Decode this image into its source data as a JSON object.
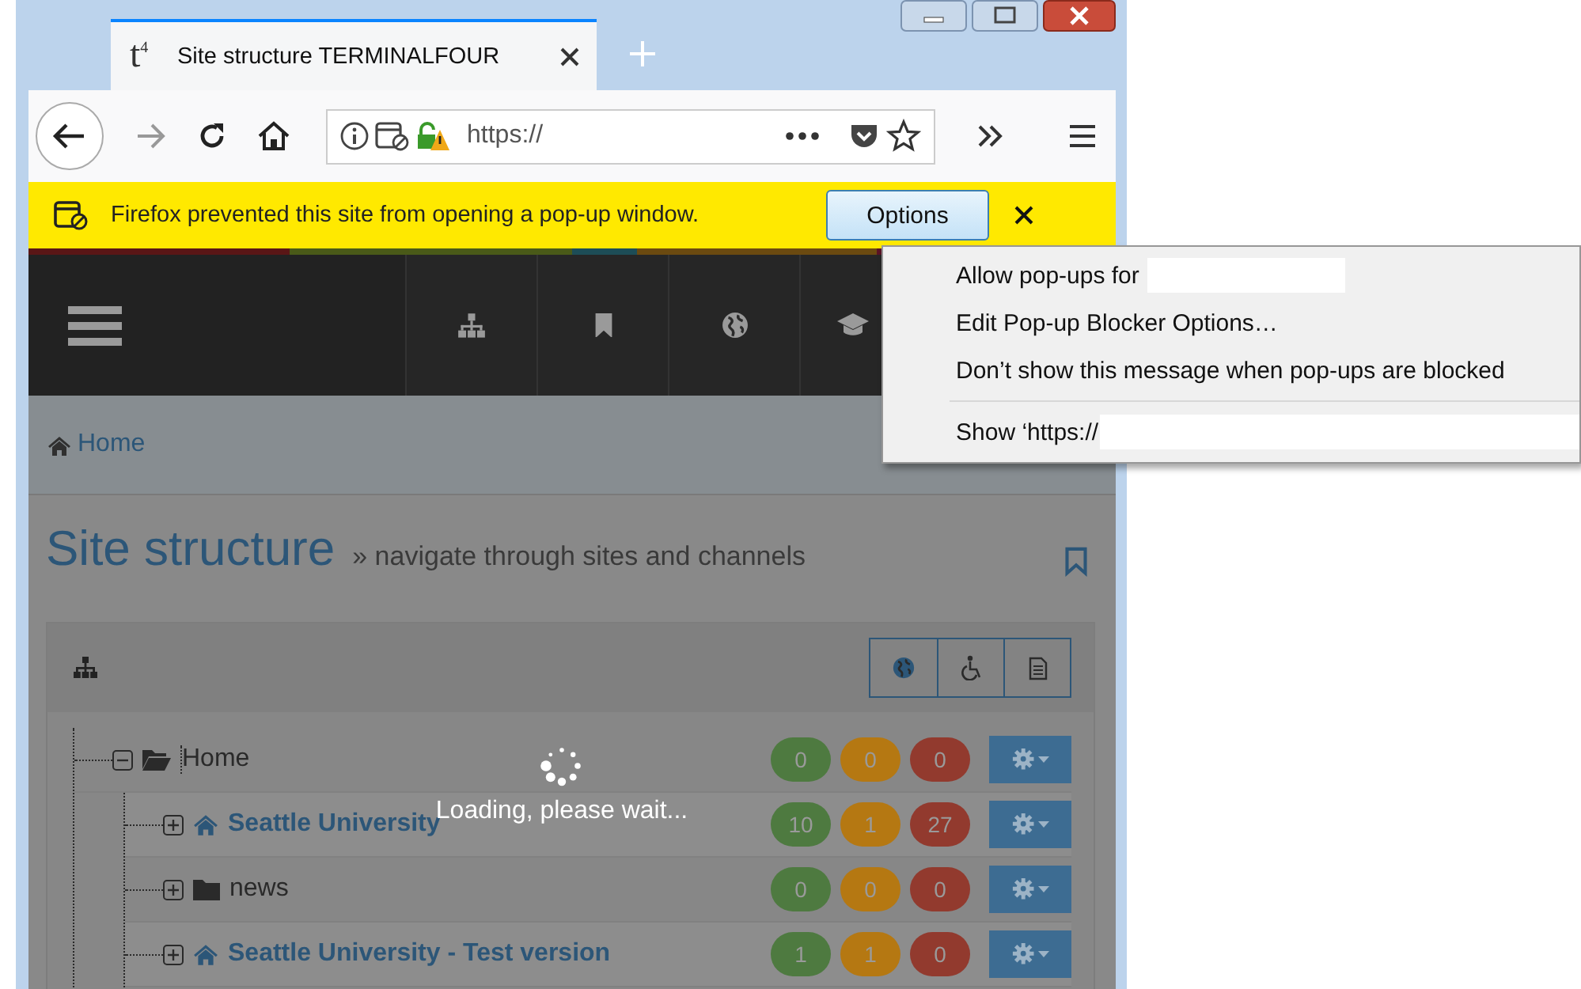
{
  "browser": {
    "tab": {
      "favicon": "t$^{4}$",
      "title": "Site structure TERMINALFOUR"
    },
    "url": "https://",
    "popup_bar": {
      "message": "Firefox prevented this site from opening a pop-up window.",
      "button": "Options"
    },
    "popup_menu": [
      {
        "kind": "item",
        "label": "Allow pop-ups for",
        "redacted": true
      },
      {
        "kind": "item",
        "label": "Edit Pop-up Blocker Options…",
        "redacted": false
      },
      {
        "kind": "item",
        "label": "Don’t show this message when pop-ups are blocked",
        "redacted": false
      },
      {
        "kind": "separator"
      },
      {
        "kind": "item",
        "label": "Show ‘https://",
        "redacted": true
      }
    ]
  },
  "cms": {
    "breadcrumb": "Home",
    "title": "Site structure",
    "subtitle": "» navigate through sites and channels",
    "tree": [
      {
        "kind": "root",
        "label": "Home",
        "expanded": true,
        "counts": [
          {
            "value": "0",
            "color": "#4e7a40"
          },
          {
            "value": "0",
            "color": "#b57812"
          },
          {
            "value": "0",
            "color": "#923a2e"
          }
        ],
        "children": [
          {
            "kind": "site",
            "label": "Seattle University",
            "expanded": false,
            "counts": [
              {
                "value": "10",
                "color": "#4e7a40"
              },
              {
                "value": "1",
                "color": "#b57812"
              },
              {
                "value": "27",
                "color": "#923a2e"
              }
            ]
          },
          {
            "kind": "channel",
            "label": "news",
            "expanded": false,
            "counts": [
              {
                "value": "0",
                "color": "#4e7a40"
              },
              {
                "value": "0",
                "color": "#b57812"
              },
              {
                "value": "0",
                "color": "#923a2e"
              }
            ]
          },
          {
            "kind": "site",
            "label": "Seattle University - Test version",
            "expanded": false,
            "counts": [
              {
                "value": "1",
                "color": "#4e7a40"
              },
              {
                "value": "1",
                "color": "#b57812"
              },
              {
                "value": "0",
                "color": "#923a2e"
              }
            ]
          }
        ]
      }
    ],
    "loading": "Loading, please wait..."
  }
}
